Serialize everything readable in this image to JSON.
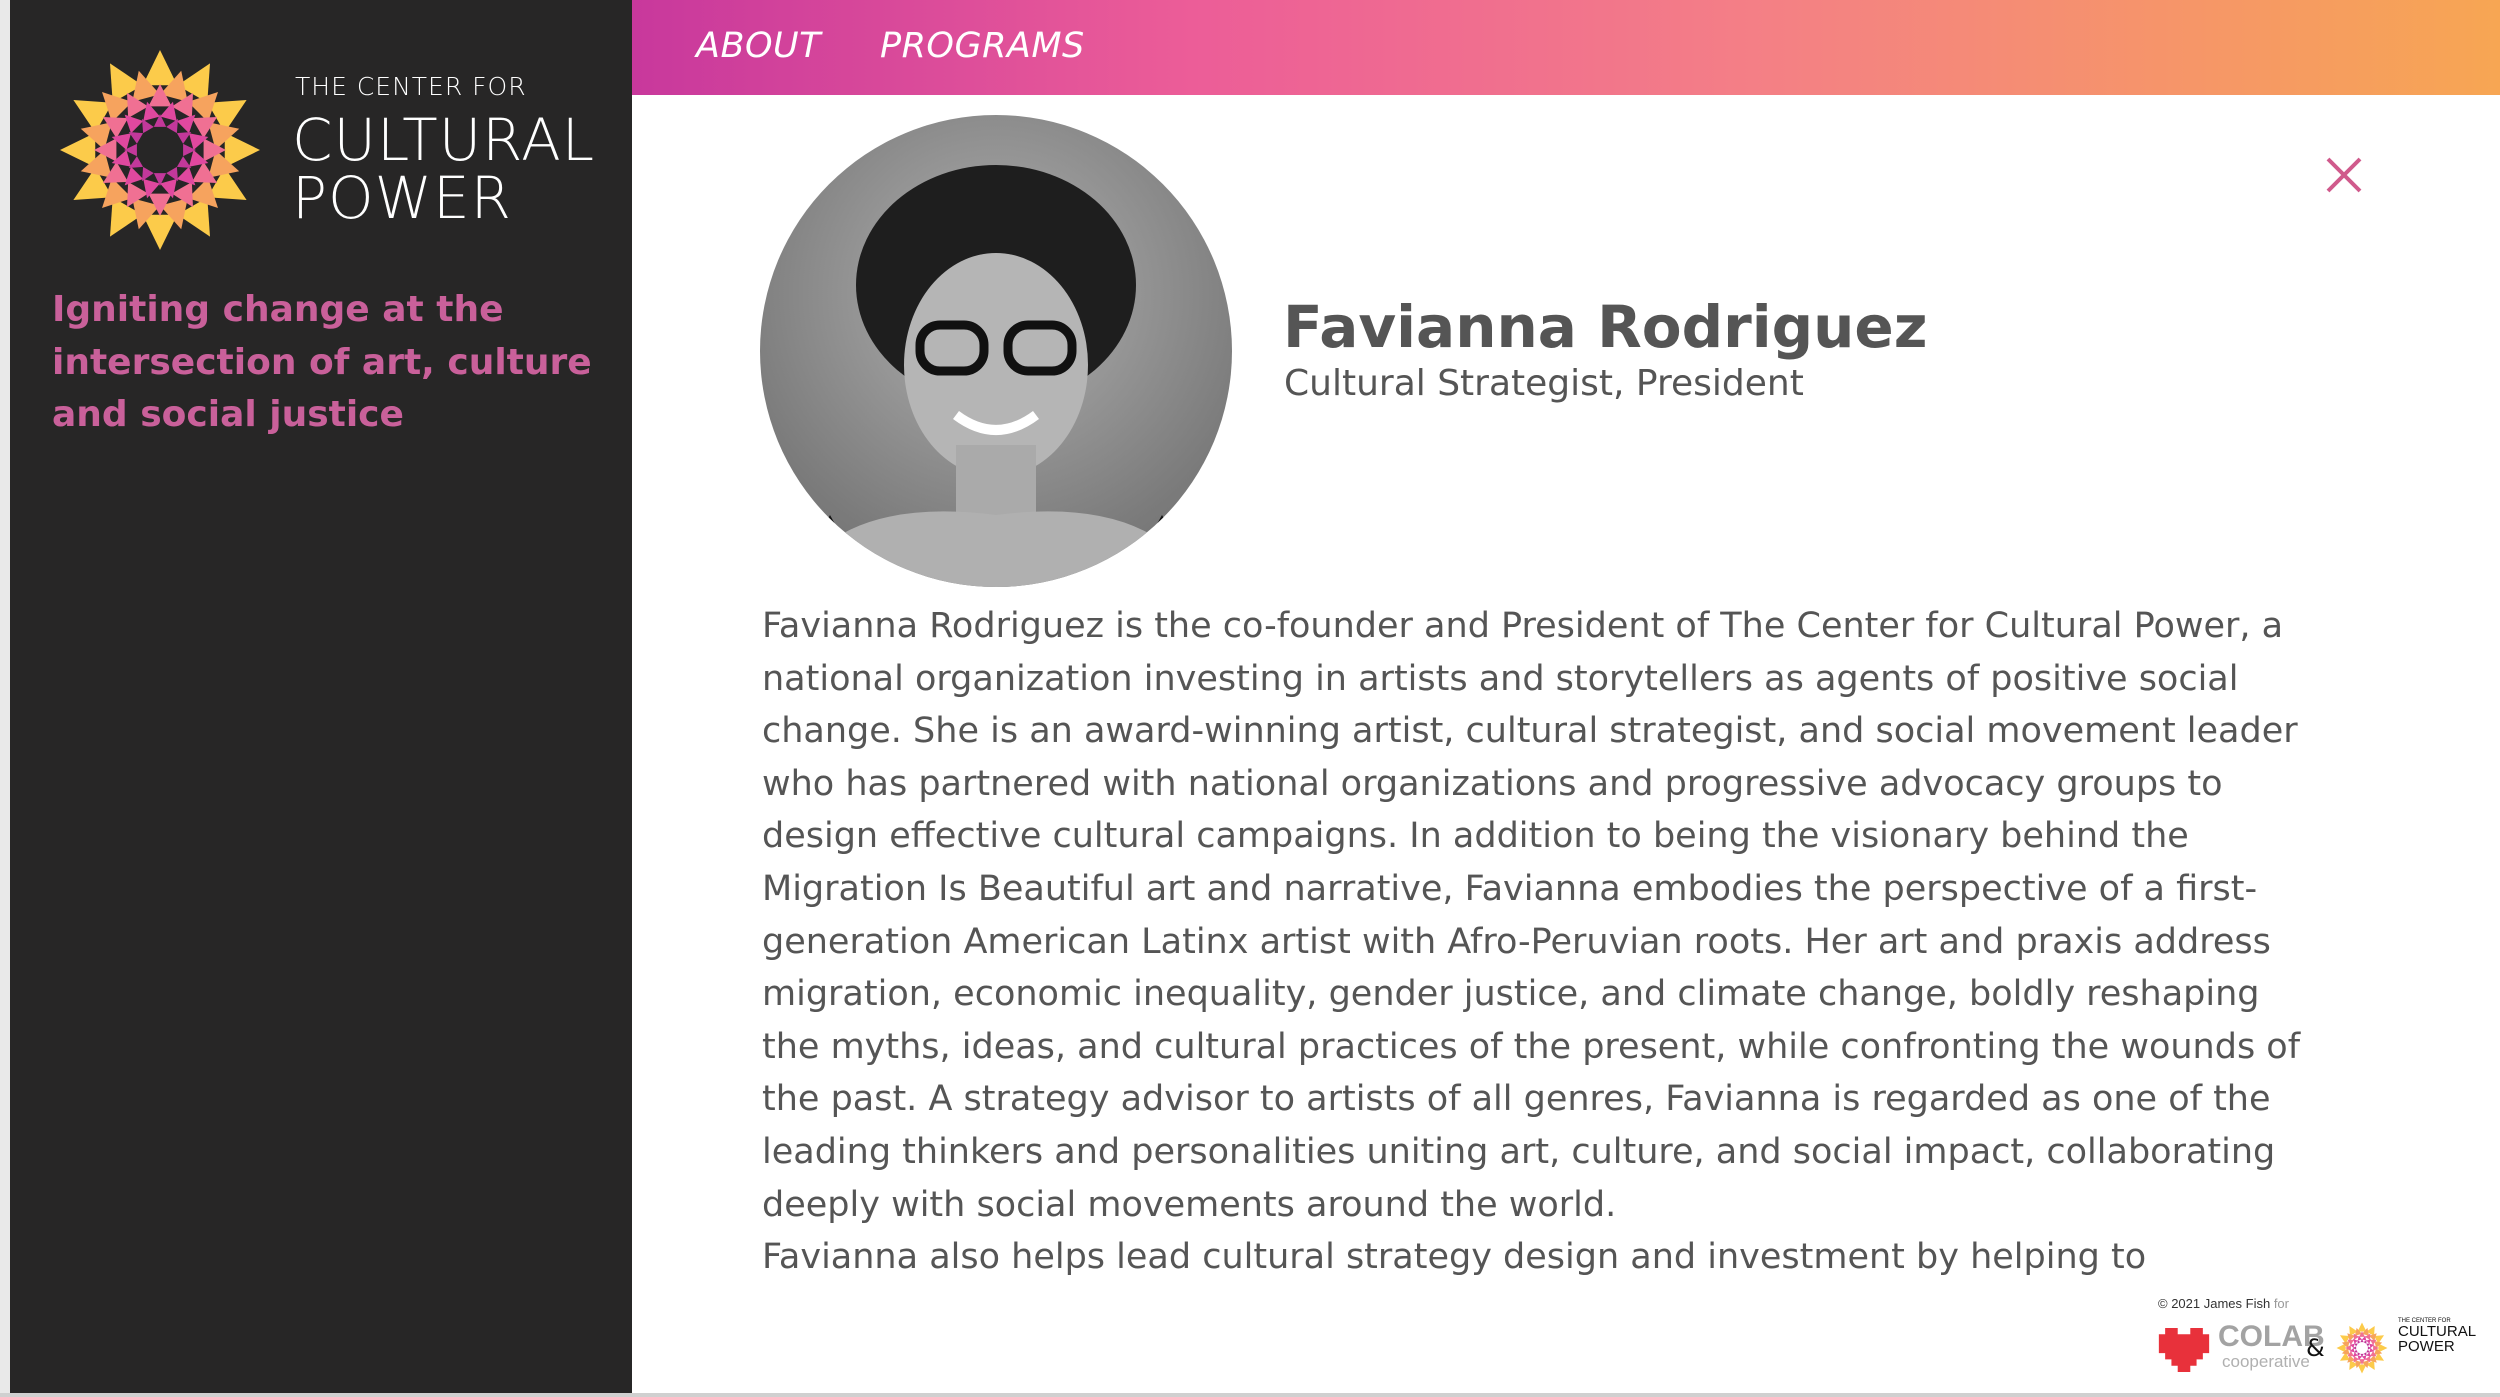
{
  "brand": {
    "line1": "THE CENTER FOR",
    "line2": "CULTURAL",
    "line3": "POWER"
  },
  "sidebar": {
    "tagline": "Igniting change at the intersection of art, culture and social justice"
  },
  "nav": {
    "items": [
      {
        "label": "ABOUT"
      },
      {
        "label": "PROGRAMS"
      }
    ]
  },
  "profile": {
    "name": "Favianna Rodriguez",
    "role": "Cultural Strategist, President",
    "bio_lines": [
      "Favianna Rodriguez is the co-founder and President of The Center for Cultural Power, a",
      "national organization investing in artists and storytellers as agents of positive social",
      "change. She is an award-winning artist, cultural strategist, and social movement leader",
      "who has partnered with national organizations and progressive advocacy groups to",
      "design effective cultural campaigns. In addition to being the visionary behind the",
      "Migration Is Beautiful art and narrative, Favianna embodies the perspective of a first-",
      "generation American Latinx artist with Afro-Peruvian roots. Her art and praxis address",
      "migration, economic inequality, gender justice, and climate change, boldly reshaping",
      "the myths, ideas, and cultural practices of the present, while confronting the wounds of",
      "the past. A strategy advisor to artists of all genres, Favianna is regarded as one of the",
      "leading thinkers and personalities uniting art, culture, and social impact, collaborating",
      "deeply with social movements around the world."
    ],
    "bio2": "Favianna also helps lead cultural strategy design and investment by helping to"
  },
  "credit": {
    "copyright": "© 2021 James Fish",
    "for": "for",
    "colab": "COLAB",
    "cooperative": "cooperative",
    "amp": "&",
    "logo_l1": "THE CENTER FOR",
    "logo_l2": "CULTURAL",
    "logo_l3": "POWER"
  },
  "colors": {
    "accent": "#c9609a",
    "close": "#d05a8c",
    "sidebar": "#272626"
  },
  "icons": {
    "close": "close-icon",
    "logo": "mandala-logo-icon"
  }
}
